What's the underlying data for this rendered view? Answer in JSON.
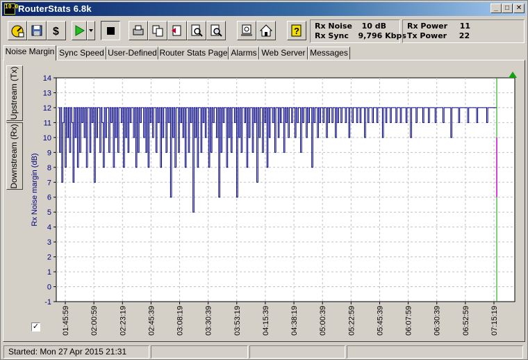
{
  "window": {
    "title": "RouterStats 6.8k",
    "app_icon_text": "10.0"
  },
  "toolbar": {
    "buttons": [
      {
        "name": "settings-button",
        "icon": "gauge-settings-icon"
      },
      {
        "name": "save-button",
        "icon": "floppy-disk-icon"
      },
      {
        "name": "dollar-button",
        "icon": "dollar-icon"
      },
      {
        "name": "play-button",
        "icon": "play-icon"
      },
      {
        "name": "stop-button",
        "icon": "stop-icon"
      },
      {
        "name": "print-button",
        "icon": "printer-icon"
      },
      {
        "name": "copy-button",
        "icon": "copy-icon"
      },
      {
        "name": "export-button",
        "icon": "export-icon"
      },
      {
        "name": "zoom-button",
        "icon": "zoom-icon"
      },
      {
        "name": "zoom-fit-button",
        "icon": "zoom-fit-icon"
      },
      {
        "name": "web-button",
        "icon": "web-page-icon"
      },
      {
        "name": "home-button",
        "icon": "home-icon"
      },
      {
        "name": "help-button",
        "icon": "help-icon"
      }
    ],
    "stats": {
      "rx_noise_label": "Rx Noise",
      "rx_noise_value": "10 dB",
      "rx_sync_label": "Rx Sync",
      "rx_sync_value": "9,796 Kbps",
      "rx_power_label": "Rx Power",
      "rx_power_value": "11",
      "tx_power_label": "Tx Power",
      "tx_power_value": "22"
    }
  },
  "tabs": [
    {
      "label": "Noise Margin",
      "active": true
    },
    {
      "label": "Sync Speed",
      "active": false
    },
    {
      "label": "User-Defined",
      "active": false
    },
    {
      "label": "Router Stats Page",
      "active": false
    },
    {
      "label": "Alarms",
      "active": false
    },
    {
      "label": "Web Server",
      "active": false
    },
    {
      "label": "Messages",
      "active": false
    }
  ],
  "side_tabs": [
    {
      "label": "Upstream (Tx)",
      "active": false
    },
    {
      "label": "Downstream (Rx)",
      "active": true
    }
  ],
  "checkbox": {
    "checked": true,
    "mark": "✓"
  },
  "colors": {
    "line": "#000080",
    "cursor": "#00a000",
    "marker": "#cc00cc",
    "title_gradient_start": "#0a246a"
  },
  "chart_data": {
    "type": "line",
    "ylabel": "Rx Noise margin (dB)",
    "xlabel": "",
    "ylim": [
      -1,
      14
    ],
    "yticks": [
      -1,
      0,
      1,
      2,
      3,
      4,
      5,
      6,
      7,
      8,
      9,
      10,
      11,
      12,
      13,
      14
    ],
    "xticks": [
      "01:45:59",
      "02:00:59",
      "02:23:19",
      "02:45:39",
      "03:08:19",
      "03:30:39",
      "03:53:19",
      "04:15:39",
      "04:38:19",
      "05:00:39",
      "05:22:59",
      "05:45:39",
      "06:07:59",
      "06:30:39",
      "06:52:59",
      "07:15:19"
    ],
    "grid": true,
    "series": [
      {
        "values": [
          12,
          9,
          12,
          7,
          11,
          12,
          8,
          12,
          10,
          12,
          9,
          12,
          11,
          7,
          12,
          10,
          12,
          8,
          12,
          9,
          12,
          11,
          12,
          10,
          12,
          8,
          12,
          12,
          9,
          12,
          11,
          12,
          7,
          12,
          10,
          12,
          12,
          9,
          12,
          11,
          8,
          12,
          10,
          12,
          12,
          9,
          12,
          11,
          12,
          8,
          12,
          10,
          12,
          9,
          12,
          12,
          11,
          12,
          8,
          12,
          10,
          12,
          9,
          12,
          11,
          12,
          12,
          10,
          12,
          8,
          12,
          9,
          12,
          11,
          12,
          12,
          10,
          12,
          9,
          12,
          8,
          12,
          11,
          12,
          10,
          12,
          12,
          9,
          12,
          11,
          12,
          8,
          12,
          10,
          12,
          12,
          9,
          12,
          11,
          12,
          6,
          12,
          10,
          12,
          8,
          12,
          12,
          9,
          12,
          11,
          12,
          10,
          12,
          8,
          12,
          12,
          9,
          12,
          11,
          12,
          5,
          12,
          10,
          12,
          8,
          12,
          12,
          9,
          12,
          11,
          12,
          10,
          12,
          12,
          8,
          12,
          9,
          12,
          11,
          12,
          12,
          10,
          12,
          6,
          12,
          9,
          12,
          11,
          12,
          12,
          8,
          12,
          10,
          12,
          9,
          12,
          12,
          11,
          12,
          6,
          12,
          10,
          12,
          9,
          12,
          12,
          11,
          12,
          8,
          12,
          10,
          12,
          12,
          9,
          12,
          11,
          12,
          7,
          12,
          10,
          12,
          12,
          9,
          12,
          11,
          12,
          8,
          12,
          10,
          12,
          12,
          11,
          12,
          9,
          12,
          12,
          10,
          12,
          11,
          12,
          12,
          9,
          12,
          11,
          12,
          10,
          12,
          12,
          11,
          12,
          12,
          10,
          12,
          11,
          12,
          12,
          9,
          12,
          11,
          12,
          12,
          10,
          12,
          11,
          12,
          12,
          8,
          12,
          11,
          12,
          12,
          10,
          12,
          11,
          12,
          12,
          11,
          12,
          12,
          10,
          12,
          11,
          12,
          12,
          11,
          12,
          12,
          10,
          12,
          11,
          12,
          12,
          11,
          12,
          12,
          12,
          11,
          12,
          12,
          10,
          12,
          12,
          11,
          12,
          12,
          12,
          11,
          12,
          12,
          11,
          12,
          12,
          12,
          10,
          12,
          12,
          11,
          12,
          12,
          12,
          11,
          12,
          12,
          12,
          11,
          12,
          12,
          12,
          12,
          10,
          12,
          12,
          11,
          12,
          12,
          12,
          11,
          12,
          12,
          12,
          12,
          11,
          12,
          12,
          12,
          11,
          12,
          12,
          12,
          12,
          11,
          12,
          12,
          12,
          10,
          12,
          12,
          12,
          12,
          11,
          12,
          12,
          12,
          12,
          12,
          11,
          12,
          12,
          12,
          12,
          11,
          12,
          12,
          12,
          12,
          12,
          11,
          12,
          12,
          12,
          12,
          12,
          12,
          11,
          12,
          12,
          12,
          12,
          12,
          12,
          10,
          12,
          12,
          12,
          12,
          12,
          12,
          11,
          12,
          12,
          12,
          12,
          12,
          12,
          12,
          11,
          12,
          12,
          12,
          12,
          12,
          12,
          12,
          11,
          12,
          12,
          12,
          12,
          12,
          12,
          12,
          12,
          11,
          12,
          12,
          12,
          12,
          12,
          12,
          12,
          12,
          6
        ]
      }
    ]
  },
  "statusbar": {
    "started": "Started: Mon 27 Apr 2015   21:31"
  }
}
